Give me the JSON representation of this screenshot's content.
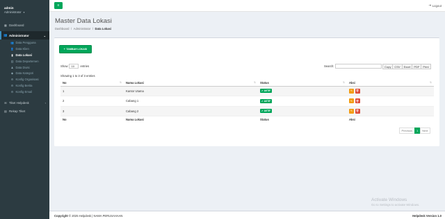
{
  "sidebar": {
    "user_name": "admin",
    "user_role": "Administrator",
    "menu": [
      {
        "label": "Dashboard",
        "icon": "dashboard-icon"
      },
      {
        "label": "Administrator",
        "icon": "users-icon"
      },
      {
        "label": "Tiket Helpdesk",
        "icon": "ticket-icon"
      },
      {
        "label": "Rekap Tiket",
        "icon": "chart-icon"
      }
    ],
    "submenu": [
      {
        "label": "Data Pengguna",
        "icon": "users-icon"
      },
      {
        "label": "Data Klien",
        "icon": "user-icon"
      },
      {
        "label": "Data Lokasi",
        "icon": "file-icon"
      },
      {
        "label": "Data Departemen",
        "icon": "building-icon"
      },
      {
        "label": "Data Divisi",
        "icon": "users-icon"
      },
      {
        "label": "Data Kategori",
        "icon": "tag-icon"
      },
      {
        "label": "Konfig Organisasi",
        "icon": "gear-icon"
      },
      {
        "label": "Konfig Berita",
        "icon": "gear-icon"
      },
      {
        "label": "Konfig Email",
        "icon": "gear-icon"
      }
    ]
  },
  "topbar": {
    "logout_label": "Logout"
  },
  "header": {
    "title": "Master Data Lokasi",
    "breadcrumb": [
      "Dashboard",
      "Administrator",
      "Data Lokasi"
    ]
  },
  "box": {
    "add_button": "TAMBAH LOKASI",
    "show_label": "Show",
    "show_value": "10",
    "entries_label": "entries",
    "search_label": "Search:",
    "search_value": "",
    "export_buttons": [
      "Copy",
      "CSV",
      "Excel",
      "PDF",
      "Print"
    ],
    "info": "Showing 1 to 3 of 3 entries",
    "columns": [
      "No",
      "Nama Lokasi",
      "Status",
      "Aksi"
    ],
    "rows": [
      {
        "no": "1",
        "name": "Kantor Utama",
        "status": "AKTIF"
      },
      {
        "no": "2",
        "name": "Cabang 1",
        "status": "AKTIF"
      },
      {
        "no": "3",
        "name": "Cabang 2",
        "status": "AKTIF"
      }
    ],
    "pagination": {
      "previous": "Previous",
      "page": "1",
      "next": "Next"
    }
  },
  "watermark": {
    "title": "Activate Windows",
    "subtitle": "Go to Settings to activate Windows."
  },
  "footer": {
    "copyright_strong": "Copyright",
    "copyright_rest": "© 2025 Helpdesk  |  NAMA PERUSAHAAN",
    "version": "Helpdesk Version 1.0"
  },
  "colors": {
    "sidebar": "#2c3b41",
    "accent": "#00a65a",
    "edit": "#f39c12",
    "delete": "#dd4b39"
  }
}
